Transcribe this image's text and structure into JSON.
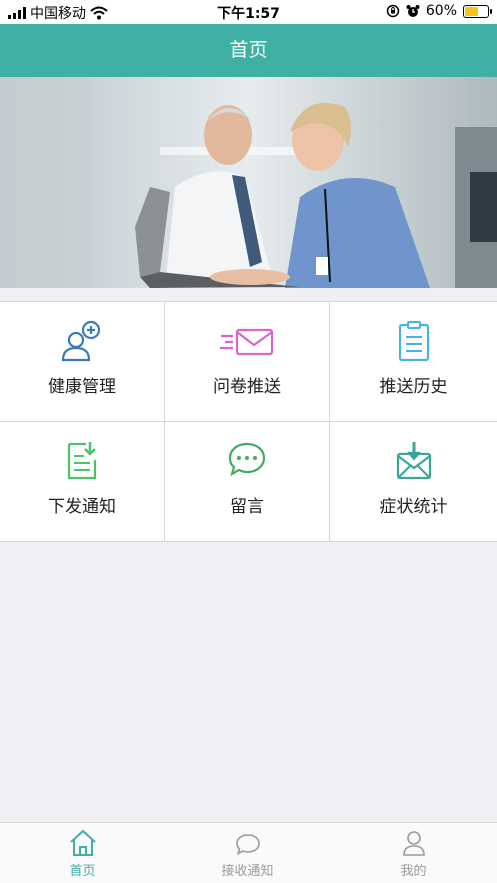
{
  "status_bar": {
    "carrier": "中国移动",
    "time": "下午1:57",
    "battery": "60%",
    "battery_level": 0.6
  },
  "nav": {
    "title": "首页"
  },
  "grid": {
    "items": [
      {
        "label": "健康管理",
        "icon": "health-user-add-icon",
        "color": "#3a7ab8"
      },
      {
        "label": "问卷推送",
        "icon": "mail-send-icon",
        "color": "#d966cc"
      },
      {
        "label": "推送历史",
        "icon": "clipboard-icon",
        "color": "#4ab3e6"
      },
      {
        "label": "下发通知",
        "icon": "document-download-icon",
        "color": "#4cc26a"
      },
      {
        "label": "留言",
        "icon": "chat-bubble-icon",
        "color": "#3fae62"
      },
      {
        "label": "症状统计",
        "icon": "mail-download-icon",
        "color": "#3aa69a"
      }
    ]
  },
  "tab_bar": {
    "tabs": [
      {
        "label": "首页",
        "icon": "home-icon",
        "active": true
      },
      {
        "label": "接收通知",
        "icon": "message-icon",
        "active": false
      },
      {
        "label": "我的",
        "icon": "person-icon",
        "active": false
      }
    ],
    "active_color": "#3fb0a3",
    "inactive_color": "#9a9a9a"
  }
}
